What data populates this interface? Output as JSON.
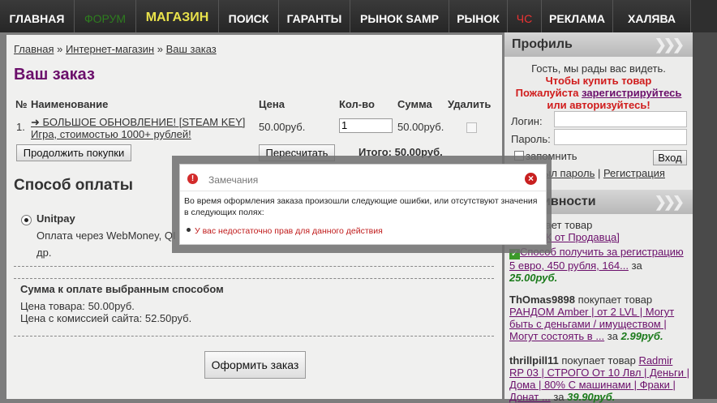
{
  "nav": [
    "ГЛАВНАЯ",
    "ФОРУМ",
    "МАГАЗИН",
    "ПОИСК",
    "ГАРАНТЫ",
    "РЫНОК SAMP",
    "РЫНОК",
    "ЧС",
    "РЕКЛАМА",
    "ХАЛЯВА"
  ],
  "breadcrumb": {
    "home": "Главная",
    "sep": " » ",
    "shop": "Интернет-магазин",
    "order": "Ваш заказ"
  },
  "title": "Ваш заказ",
  "table": {
    "headers": {
      "num": "№",
      "name": "Наименование",
      "price": "Цена",
      "qty": "Кол-во",
      "sum": "Сумма",
      "delete": "Удалить"
    },
    "row": {
      "num": "1.",
      "name_line1": "➜ БОЛЬШОЕ ОБНОВЛЕНИЕ! [STEAM KEY]",
      "name_line2": "Игра, стоимостью 1000+ рублей!",
      "price": "50.00руб.",
      "qty": "1",
      "sum": "50.00руб."
    }
  },
  "buttons": {
    "continue": "Продолжить покупки",
    "recalc": "Пересчитать",
    "checkout": "Оформить заказ",
    "login": "Вход"
  },
  "total": "Итого: 50.00руб.",
  "payment": {
    "heading": "Способ оплаты",
    "method": "Unitpay",
    "desc_line1": "Оплата через WebMoney, QI",
    "desc_line2": "др.",
    "sum_heading": "Сумма к оплате выбранным способом",
    "goods_price": "Цена товара: 50.00руб.",
    "with_commission": "Цена с комиссией сайта: 52.50руб."
  },
  "modal": {
    "title": "Замечания",
    "message": "Во время оформления заказа произошли следующие ошибки, или отсутствуют значения в следующих полях:",
    "error": "У вас недостаточно прав для данного действия"
  },
  "sidebar": {
    "profile_heading": "Профиль",
    "greeting": "Гость, мы рады вас видеть.",
    "buy_notice": "Чтобы купить товар",
    "please": "Пожалуйста ",
    "register": "зарегистрируйтесь",
    "or_login": "или авторизуйтесь!",
    "login_label": "Логин:",
    "password_label": "Пароль:",
    "remember": "запомнить",
    "forgot": "ыл пароль",
    "sep": " | ",
    "registration": "Регистрация",
    "activity_heading": "а активности",
    "activity": [
      {
        "user": "",
        "action": "а покупает товар",
        "item": "АБОТОК от Продавца]",
        "amount": ""
      },
      {
        "user": "",
        "action": "",
        "item": "Способ получить за регистрацию 5 евро, 450 рубля, 164...",
        "amount": "25.00руб."
      },
      {
        "user": "ThOmas9898",
        "action": "покупает товар",
        "item": "РАНДОМ Amber | от 2 LVL | Могут быть с деньгами / имуществом | Могут состоять в ...",
        "amount": "2.99руб."
      },
      {
        "user": "thrillpill11",
        "action": "покупает товар",
        "item": "Radmir RP 03 | СТРОГО От 10 Лвл | Деньги | Дома | 80% С машинами | Фраки | Донат ...",
        "amount": "39.90руб."
      }
    ],
    "for": "за"
  },
  "colors": {
    "accent": "#6b0f6b",
    "shop_active": "#e9e24b",
    "error": "#c01b1b",
    "price": "#1a7a1a"
  }
}
